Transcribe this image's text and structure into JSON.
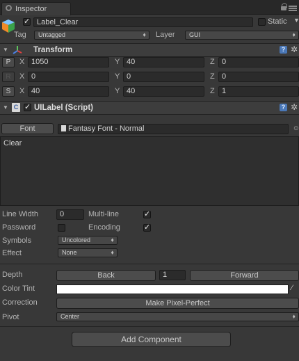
{
  "tab": {
    "label": "Inspector"
  },
  "gameobject": {
    "name": "Label_Clear",
    "active": true,
    "static_label": "Static",
    "static": false,
    "tag_label": "Tag",
    "tag_value": "Untagged",
    "layer_label": "Layer",
    "layer_value": "GUI"
  },
  "transform": {
    "title": "Transform",
    "rows": [
      {
        "btn": "P",
        "x": "1050",
        "y": "40",
        "z": "0"
      },
      {
        "btn": "R",
        "x": "0",
        "y": "0",
        "z": "0"
      },
      {
        "btn": "S",
        "x": "40",
        "y": "40",
        "z": "1"
      }
    ],
    "axis": {
      "x": "X",
      "y": "Y",
      "z": "Z"
    }
  },
  "uilabel": {
    "title": "UILabel (Script)",
    "enabled": true,
    "font_button": "Font",
    "font_value": "Fantasy Font - Normal",
    "text": "Clear",
    "line_width_label": "Line Width",
    "line_width": "0",
    "multiline_label": "Multi-line",
    "multiline": true,
    "password_label": "Password",
    "password": false,
    "encoding_label": "Encoding",
    "encoding": true,
    "symbols_label": "Symbols",
    "symbols_value": "Uncolored",
    "effect_label": "Effect",
    "effect_value": "None"
  },
  "widget": {
    "depth_label": "Depth",
    "back_button": "Back",
    "depth_value": "1",
    "forward_button": "Forward",
    "color_tint_label": "Color Tint",
    "color_tint": "#ffffff",
    "correction_label": "Correction",
    "pixel_perfect_button": "Make Pixel-Perfect",
    "pivot_label": "Pivot",
    "pivot_value": "Center"
  },
  "add_component": "Add Component"
}
